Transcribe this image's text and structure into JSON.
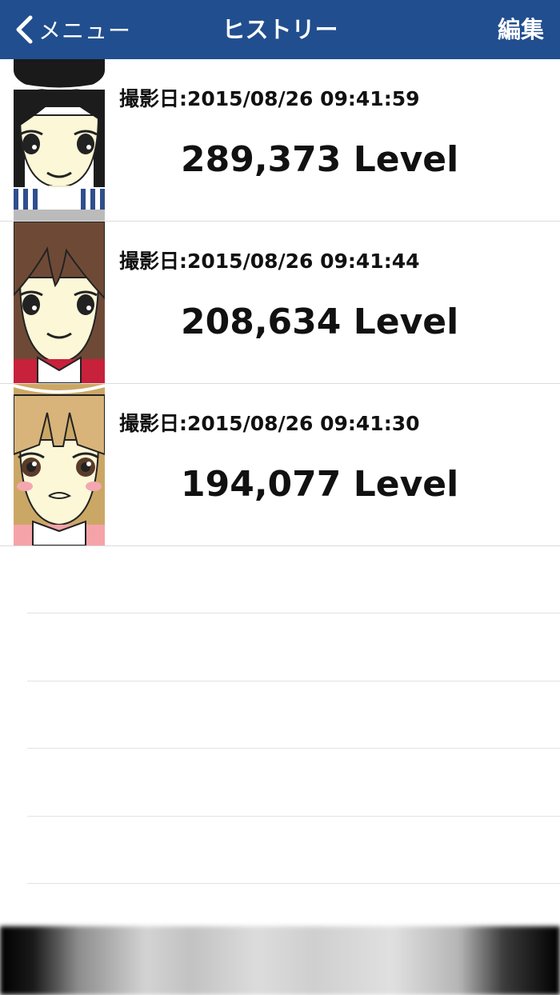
{
  "navbar": {
    "back_label": "メニュー",
    "title": "ヒストリー",
    "edit_label": "編集",
    "background_color": "#214e8f"
  },
  "history": [
    {
      "date_label": "撮影日:2015/08/26 09:41:59",
      "level_label": "289,373 Level",
      "avatar": "avatar-black-hat-icon"
    },
    {
      "date_label": "撮影日:2015/08/26 09:41:44",
      "level_label": "208,634 Level",
      "avatar": "avatar-brown-hair-icon"
    },
    {
      "date_label": "撮影日:2015/08/26 09:41:30",
      "level_label": "194,077 Level",
      "avatar": "avatar-blonde-hair-icon"
    }
  ]
}
